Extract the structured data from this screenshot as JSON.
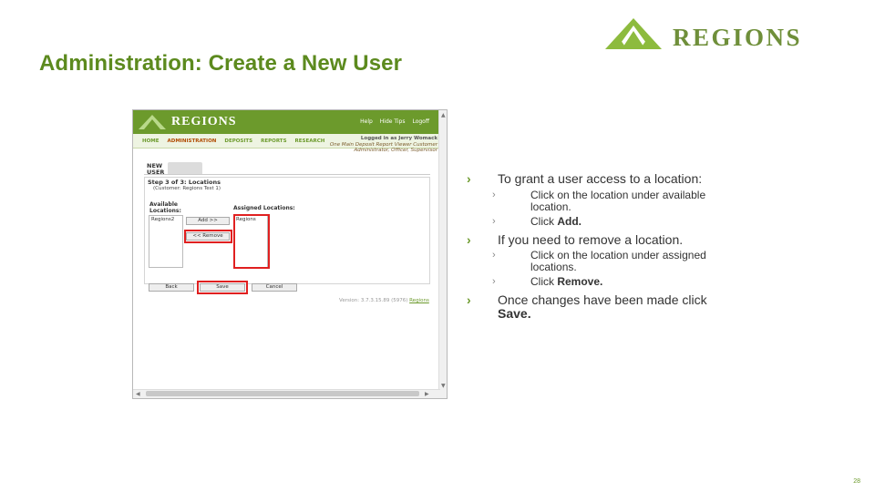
{
  "slide": {
    "title": "Administration: Create a New User",
    "page_number": "28"
  },
  "logo": {
    "text": "REGIONS",
    "color": "#6f8f3a"
  },
  "screenshot": {
    "brand": "REGIONS",
    "top_links": [
      "Help",
      "Hide Tips",
      "Logoff"
    ],
    "nav": [
      "HOME",
      "ADMINISTRATION",
      "DEPOSITS",
      "REPORTS",
      "RESEARCH"
    ],
    "login_line1": "Logged in as Jerry Womack",
    "login_line2": "One Main Deposit Report Viewer Customer",
    "login_line3": "Administrator, Officer, Supervisor",
    "new_user_line1": "NEW",
    "new_user_line2": "USER",
    "step": "Step 3 of 3: Locations",
    "customer": "(Customer: Regions Test 1)",
    "available_label_1": "Available",
    "available_label_2": "Locations:",
    "available_value": "Regions2",
    "assigned_label": "Assigned Locations:",
    "assigned_value": "Regions",
    "add_label": "Add >>",
    "remove_label": "<< Remove",
    "back_label": "Back",
    "save_label": "Save",
    "cancel_label": "Cancel",
    "version": "Version: 3.7.3.15.89 (5976)",
    "version_link": "Regions"
  },
  "bullets": {
    "grant": "To grant a user access to a location:",
    "grant_sub1": "Click on the location under available location.",
    "grant_sub2_prefix": "Click ",
    "grant_sub2_bold": "Add.",
    "remove": "If you need to remove a location.",
    "remove_sub1": "Click on the location under assigned locations.",
    "remove_sub2_prefix": "Click ",
    "remove_sub2_bold": "Remove.",
    "save_line1": "Once changes have been made click",
    "save_line2": "Save."
  },
  "colors": {
    "brand_green": "#6c9a2c",
    "title_green": "#5c8a1e",
    "highlight_red": "#e02020"
  }
}
